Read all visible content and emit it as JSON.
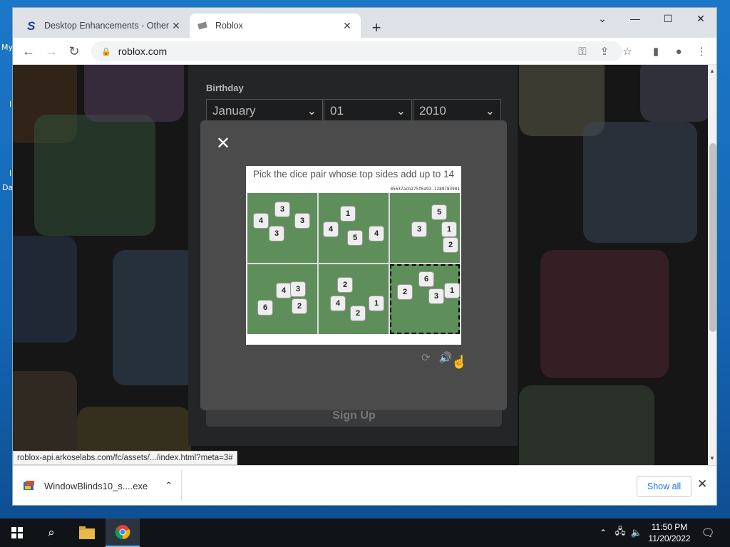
{
  "desktop": {
    "labels": [
      "My",
      "l",
      "l",
      "Da"
    ]
  },
  "browser": {
    "tabs": [
      {
        "title": "Desktop Enhancements - Other Downloads",
        "icon": "stardock-s-icon"
      },
      {
        "title": "Roblox",
        "icon": "roblox-icon"
      }
    ],
    "new_tab_symbol": "+",
    "url": "roblox.com"
  },
  "page": {
    "birthday_label": "Birthday",
    "month": "January",
    "day": "01",
    "year": "2010",
    "signup_label": "Sign Up"
  },
  "captcha": {
    "prompt": "Pick the dice pair whose top sides add up to 14",
    "session_id": "85637acb275f6a93.1289783901",
    "cells": [
      {
        "dice": [
          "4",
          "3",
          "3",
          "3"
        ]
      },
      {
        "dice": [
          "4",
          "5",
          "4",
          "1"
        ]
      },
      {
        "dice": [
          "5",
          "3",
          "1",
          "2"
        ]
      },
      {
        "dice": [
          "6",
          "4",
          "2",
          "3"
        ]
      },
      {
        "dice": [
          "2",
          "4",
          "1",
          "2"
        ]
      },
      {
        "dice": [
          "2",
          "6",
          "3",
          "1"
        ]
      }
    ],
    "selected_cell": 6
  },
  "status_url": "roblox-api.arkoselabs.com/fc/assets/.../index.html?meta=3#",
  "download": {
    "filename": "WindowBlinds10_s....exe",
    "show_all_label": "Show all"
  },
  "taskbar": {
    "time": "11:50 PM",
    "date": "11/20/2022"
  },
  "colors": {
    "accent": "#1a73e8",
    "modal": "#4b4b4b",
    "page_bg": "#232527"
  }
}
